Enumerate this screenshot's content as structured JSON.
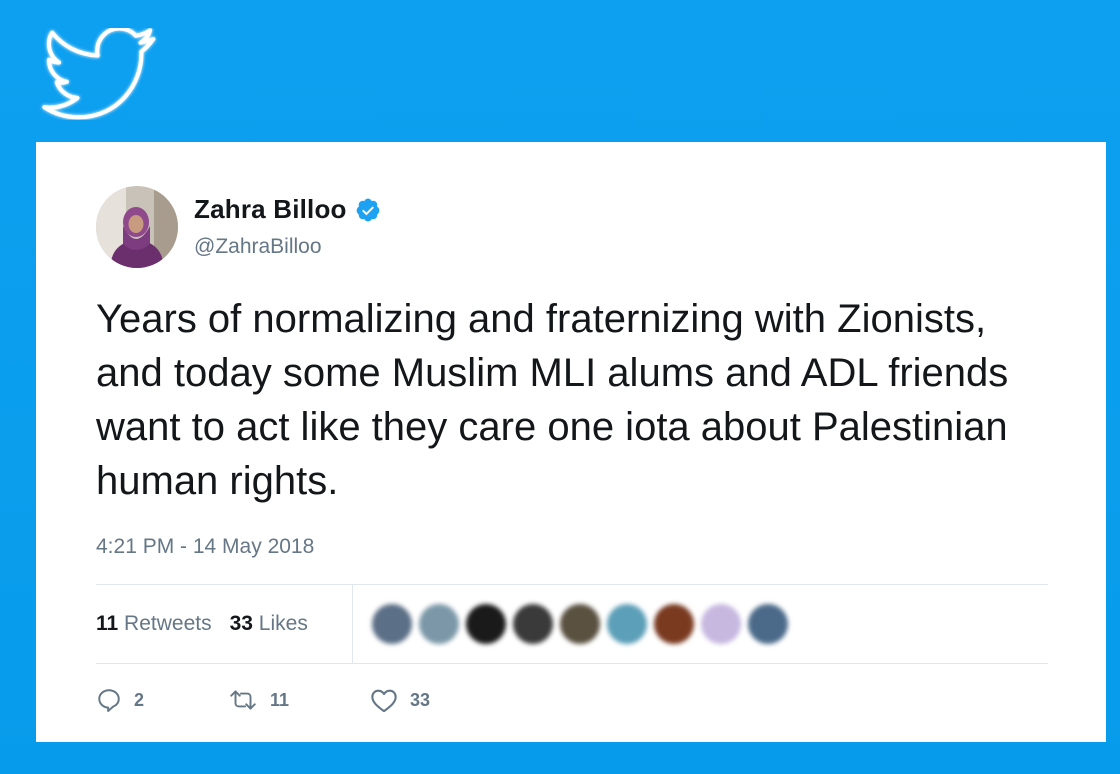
{
  "brand": {
    "logo_icon": "twitter-bird-icon",
    "background_color": "#0ea0f0"
  },
  "tweet": {
    "author": {
      "name": "Zahra Billoo",
      "handle": "@ZahraBilloo",
      "verified": true,
      "verified_icon": "verified-badge-icon",
      "verified_color": "#1da1f2"
    },
    "text": "Years of normalizing and fraternizing with Zionists, and today some Muslim MLI alums and ADL friends want to act like they care one iota about Palestinian human rights.",
    "timestamp": "4:21 PM - 14 May 2018",
    "stats": {
      "retweets_count": "11",
      "retweets_label": "Retweets",
      "likes_count": "33",
      "likes_label": "Likes"
    },
    "liker_avatars": [
      {
        "color": "#5b6f86"
      },
      {
        "color": "#7c98a8"
      },
      {
        "color": "#1a1a1a"
      },
      {
        "color": "#3a3a3a"
      },
      {
        "color": "#5a5140"
      },
      {
        "color": "#5c9fb8"
      },
      {
        "color": "#7a3a20"
      },
      {
        "color": "#c7b8e0"
      },
      {
        "color": "#4b6a8a"
      }
    ],
    "actions": {
      "reply_icon": "reply-icon",
      "reply_count": "2",
      "retweet_icon": "retweet-icon",
      "retweet_count": "11",
      "like_icon": "heart-icon",
      "like_count": "33"
    }
  }
}
